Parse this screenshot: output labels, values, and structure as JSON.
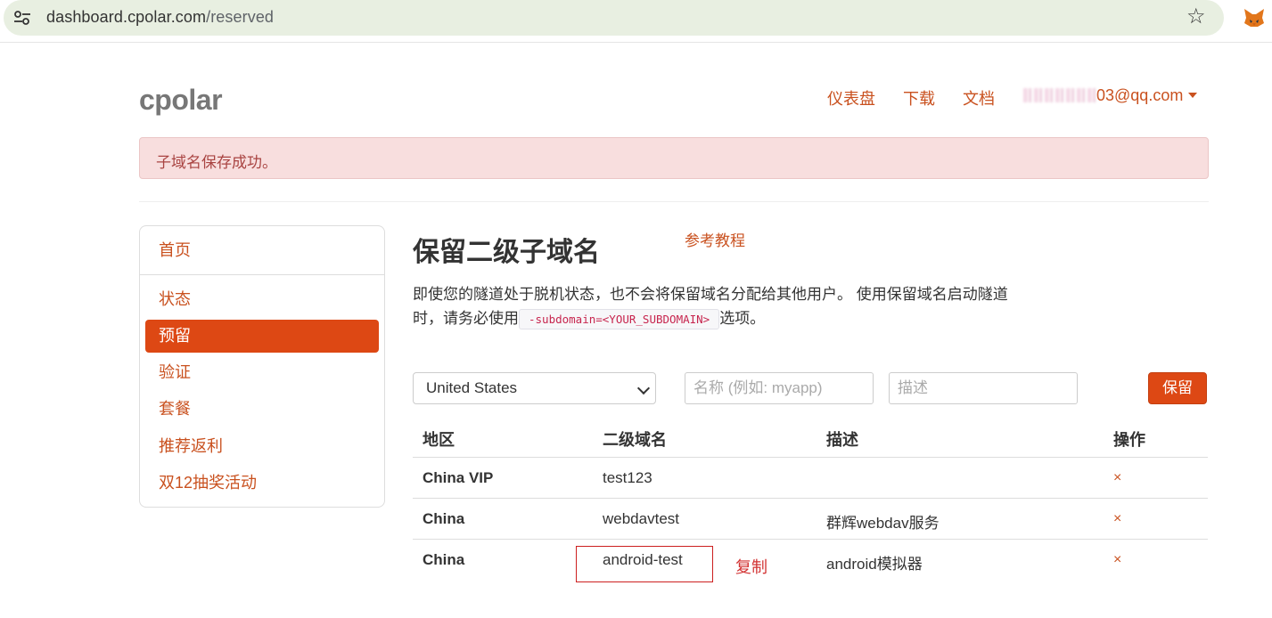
{
  "browser": {
    "url_host": "dashboard.cpolar.com",
    "url_path": "/reserved",
    "icons": [
      "site-settings-icon",
      "bookmark-star-icon",
      "metamask-fox-icon"
    ]
  },
  "header": {
    "brand": "cpolar",
    "nav": [
      "仪表盘",
      "下载",
      "文档"
    ],
    "user_email_suffix": "03@qq.com"
  },
  "alert": {
    "message": "子域名保存成功。"
  },
  "sidebar": {
    "items": [
      "首页",
      "状态",
      "预留",
      "验证",
      "套餐",
      "推荐返利",
      "双12抽奖活动"
    ],
    "active": "预留"
  },
  "main": {
    "title": "保留二级子域名",
    "tutorial_link": "参考教程",
    "description_part1": "即使您的隧道处于脱机状态，也不会将保留域名分配给其他用户。 使用保留域名启动隧道时，请务必使用",
    "code": "-subdomain=<YOUR_SUBDOMAIN>",
    "description_part2": "选项。"
  },
  "form": {
    "region_selected": "United States",
    "name_placeholder": "名称 (例如: myapp)",
    "desc_placeholder": "描述",
    "submit_label": "保留"
  },
  "table": {
    "headers": [
      "地区",
      "二级域名",
      "描述",
      "操作"
    ],
    "rows": [
      {
        "region": "China VIP",
        "subdomain": "test123",
        "description": "",
        "action": "×"
      },
      {
        "region": "China",
        "subdomain": "webdavtest",
        "description": "群辉webdav服务",
        "action": "×"
      },
      {
        "region": "China",
        "subdomain": "android-test",
        "description": "android模拟器",
        "action": "×"
      }
    ]
  },
  "annotation": {
    "label": "复制",
    "color": "#cc1f1f"
  }
}
